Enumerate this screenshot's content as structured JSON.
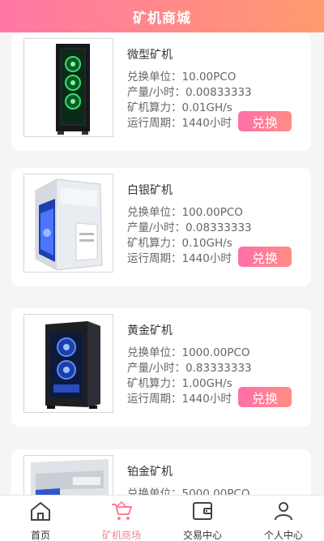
{
  "header": {
    "title": "矿机商城"
  },
  "products": [
    {
      "name": "微型矿机",
      "unit": "兑换单位：10.00PCO",
      "output": "产量/小时：0.00833333",
      "power": "矿机算力：0.01GH/s",
      "cycle": "运行周期：1440小时",
      "button": "兑换"
    },
    {
      "name": "白银矿机",
      "unit": "兑换单位：100.00PCO",
      "output": "产量/小时：0.08333333",
      "power": "矿机算力：0.10GH/s",
      "cycle": "运行周期：1440小时",
      "button": "兑换"
    },
    {
      "name": "黄金矿机",
      "unit": "兑换单位：1000.00PCO",
      "output": "产量/小时：0.83333333",
      "power": "矿机算力：1.00GH/s",
      "cycle": "运行周期：1440小时",
      "button": "兑换"
    },
    {
      "name": "铂金矿机",
      "unit": "兑换单位：5000.00PCO",
      "output": "",
      "power": "",
      "cycle": "",
      "button": ""
    }
  ],
  "tabs": [
    {
      "label": "首页",
      "icon": "home-icon"
    },
    {
      "label": "矿机商场",
      "icon": "cart-icon"
    },
    {
      "label": "交易中心",
      "icon": "wallet-icon"
    },
    {
      "label": "个人中心",
      "icon": "user-icon"
    }
  ],
  "colors": {
    "accent": "#ff7d95",
    "header_start": "#ff77a6",
    "header_end": "#ff9a6e"
  }
}
